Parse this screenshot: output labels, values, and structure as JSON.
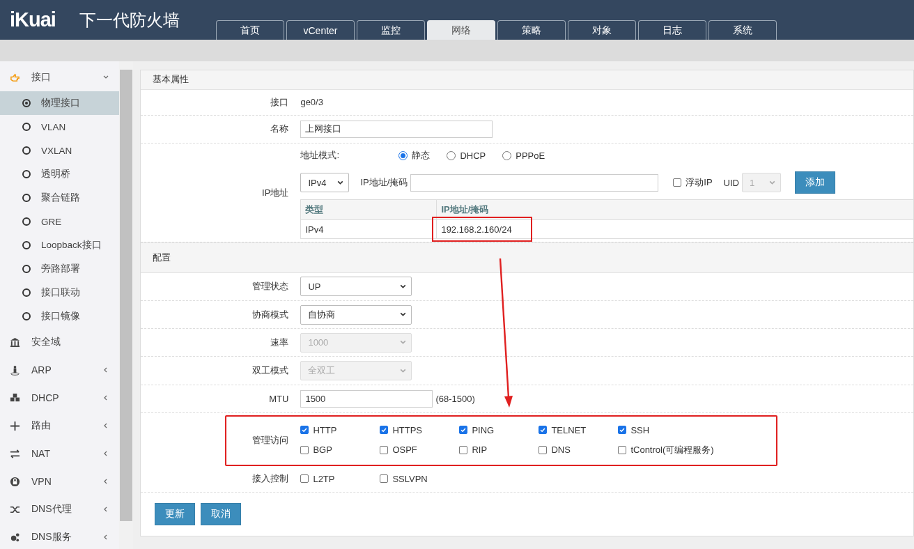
{
  "header": {
    "logo": "iKuai",
    "title": "下一代防火墙",
    "tabs": [
      {
        "label": "首页",
        "selected": false
      },
      {
        "label": "vCenter",
        "selected": false
      },
      {
        "label": "监控",
        "selected": false
      },
      {
        "label": "网络",
        "selected": true
      },
      {
        "label": "策略",
        "selected": false
      },
      {
        "label": "对象",
        "selected": false
      },
      {
        "label": "日志",
        "selected": false
      },
      {
        "label": "系统",
        "selected": false
      }
    ]
  },
  "sidebar": {
    "items": [
      {
        "label": "接口",
        "kind": "folder",
        "expanded": true,
        "children": [
          {
            "label": "物理接口",
            "selected": true
          },
          {
            "label": "VLAN",
            "selected": false
          },
          {
            "label": "VXLAN",
            "selected": false
          },
          {
            "label": "透明桥",
            "selected": false
          },
          {
            "label": "聚合链路",
            "selected": false
          },
          {
            "label": "GRE",
            "selected": false
          },
          {
            "label": "Loopback接口",
            "selected": false
          },
          {
            "label": "旁路部署",
            "selected": false
          },
          {
            "label": "接口联动",
            "selected": false
          },
          {
            "label": "接口镜像",
            "selected": false
          }
        ]
      },
      {
        "label": "安全域",
        "kind": "leaf"
      },
      {
        "label": "ARP",
        "kind": "folder",
        "expanded": false
      },
      {
        "label": "DHCP",
        "kind": "folder",
        "expanded": false
      },
      {
        "label": "路由",
        "kind": "folder",
        "expanded": false
      },
      {
        "label": "NAT",
        "kind": "folder",
        "expanded": false
      },
      {
        "label": "VPN",
        "kind": "folder",
        "expanded": false
      },
      {
        "label": "DNS代理",
        "kind": "folder",
        "expanded": false
      },
      {
        "label": "DNS服务",
        "kind": "folder",
        "expanded": false
      }
    ]
  },
  "basic": {
    "title": "基本属性",
    "interface": {
      "label": "接口",
      "value": "ge0/3"
    },
    "name": {
      "label": "名称",
      "value": "上网接口"
    },
    "ip": {
      "label": "IP地址",
      "mode_label": "地址模式:",
      "modes": [
        {
          "label": "静态",
          "selected": true
        },
        {
          "label": "DHCP",
          "selected": false
        },
        {
          "label": "PPPoE",
          "selected": false
        }
      ],
      "version": "IPv4",
      "addr_label": "IP地址/掩码",
      "float_ip": {
        "label": "浮动IP",
        "checked": false
      },
      "uid": {
        "label": "UID",
        "value": "1",
        "disabled": true
      },
      "add_button": "添加",
      "table": {
        "columns": [
          "类型",
          "IP地址/掩码"
        ],
        "rows": [
          [
            "IPv4",
            "192.168.2.160/24"
          ]
        ],
        "highlighted_cell": true
      }
    }
  },
  "config": {
    "title": "配置",
    "rows": [
      {
        "kind": "select",
        "label": "管理状态",
        "value": "UP",
        "disabled": false
      },
      {
        "kind": "select",
        "label": "协商模式",
        "value": "自协商",
        "disabled": false
      },
      {
        "kind": "select",
        "label": "速率",
        "value": "1000",
        "disabled": true
      },
      {
        "kind": "select",
        "label": "双工模式",
        "value": "全双工",
        "disabled": true
      },
      {
        "kind": "input",
        "label": "MTU",
        "value": "1500",
        "hint": "(68-1500)"
      },
      {
        "kind": "checks",
        "label": "管理访问",
        "highlighted": true,
        "options": [
          {
            "label": "HTTP",
            "checked": true
          },
          {
            "label": "HTTPS",
            "checked": true
          },
          {
            "label": "PING",
            "checked": true
          },
          {
            "label": "TELNET",
            "checked": true
          },
          {
            "label": "SSH",
            "checked": true
          },
          {
            "label": "BGP",
            "checked": false
          },
          {
            "label": "OSPF",
            "checked": false
          },
          {
            "label": "RIP",
            "checked": false
          },
          {
            "label": "DNS",
            "checked": false
          },
          {
            "label": "tControl(可编程服务)",
            "checked": false
          }
        ]
      },
      {
        "kind": "checks",
        "label": "接入控制",
        "highlighted": false,
        "options": [
          {
            "label": "L2TP",
            "checked": false
          },
          {
            "label": "SSLVPN",
            "checked": false
          }
        ]
      }
    ],
    "buttons": [
      "更新",
      "取消"
    ]
  }
}
